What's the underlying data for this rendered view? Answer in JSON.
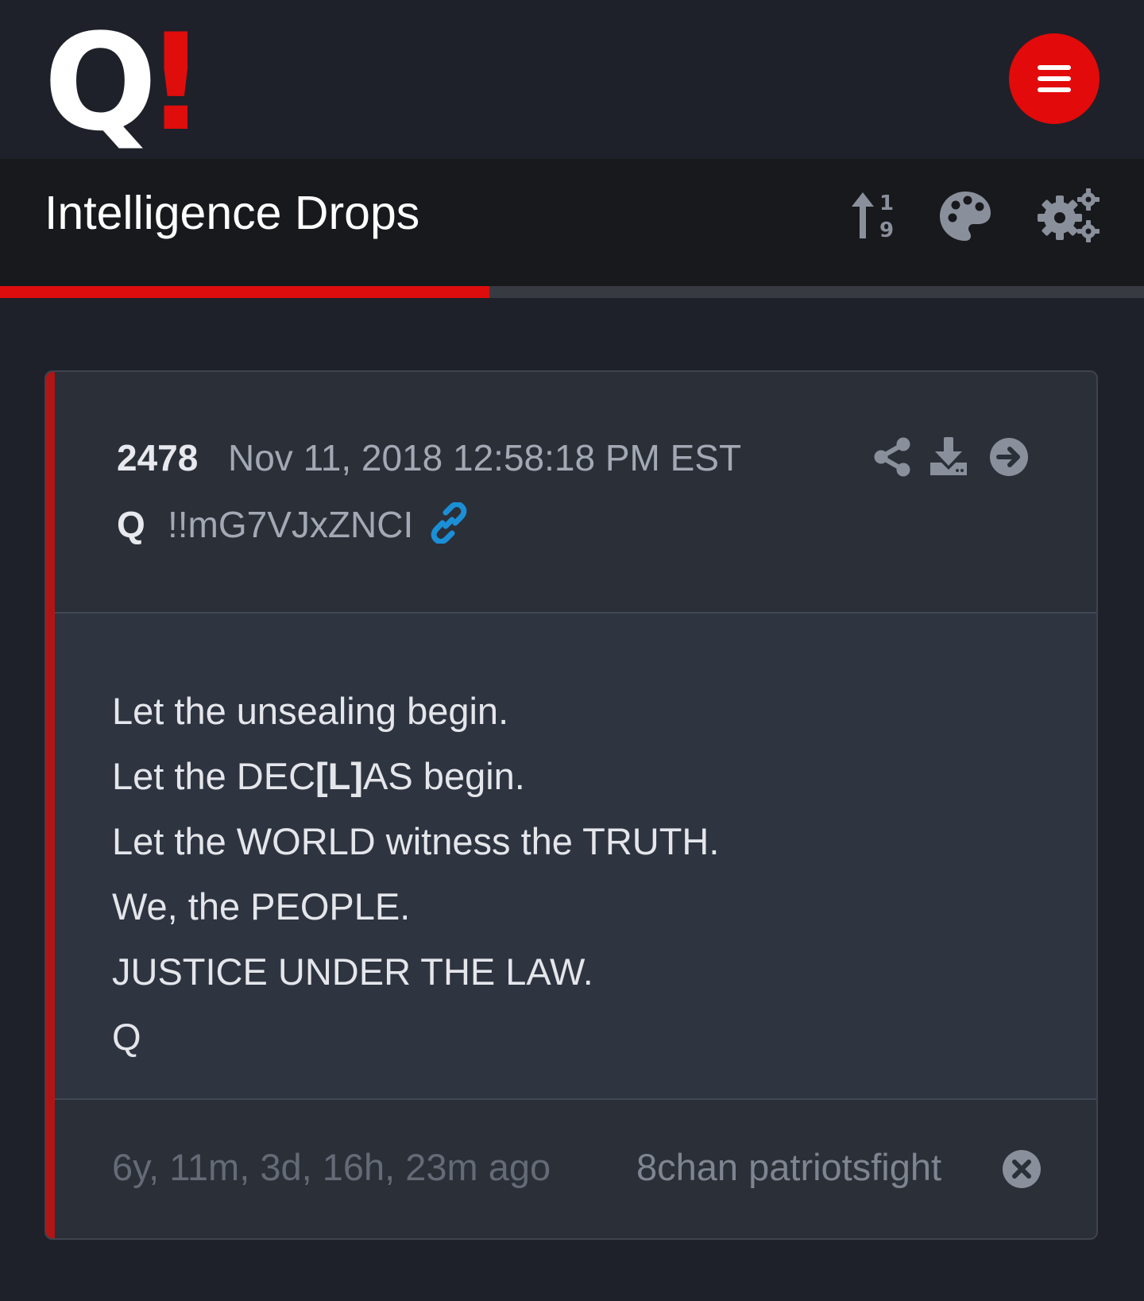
{
  "header": {
    "logo_letter": "Q",
    "logo_mark": "!",
    "menu_icon": "hamburger-menu-icon"
  },
  "titlebar": {
    "title": "Intelligence Drops",
    "icons": [
      "sort-numeric-icon",
      "palette-icon",
      "gears-icon"
    ],
    "progress": 0.428
  },
  "post": {
    "number": "2478",
    "date": "Nov 11, 2018 12:58:18 PM EST",
    "author": "Q",
    "tripcode": "!!mG7VJxZNCI",
    "header_icons": [
      "link-icon",
      "share-icon",
      "download-icon",
      "arrow-circle-right-icon"
    ],
    "lines": [
      {
        "before": "Let the unsealing begin.",
        "bold": "",
        "after": ""
      },
      {
        "before": "Let the DEC",
        "bold": "[L]",
        "after": "AS begin."
      },
      {
        "before": "Let the WORLD witness the TRUTH.",
        "bold": "",
        "after": ""
      },
      {
        "before": "We, the PEOPLE.",
        "bold": "",
        "after": ""
      },
      {
        "before": "JUSTICE UNDER THE LAW.",
        "bold": "",
        "after": ""
      },
      {
        "before": "Q",
        "bold": "",
        "after": ""
      }
    ],
    "time_ago": "6y, 11m, 3d, 16h, 23m ago",
    "source": "8chan patriotsfight",
    "footer_icon": "close-circle-icon"
  },
  "colors": {
    "background": "#1e2129",
    "titlebar": "#18191c",
    "accent_red": "#e20a0a",
    "card": "#2b2f38",
    "card_body": "#2e3440",
    "link_blue": "#1a8fd6",
    "icon_gray": "#8a909b"
  }
}
